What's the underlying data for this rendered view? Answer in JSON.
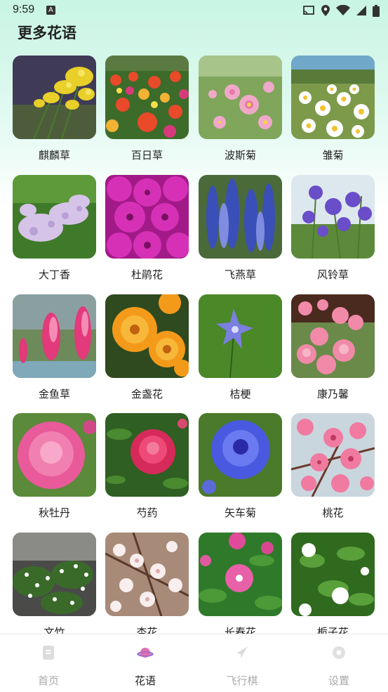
{
  "status_bar": {
    "time": "9:59",
    "badge": "A"
  },
  "page": {
    "title": "更多花语"
  },
  "flowers": [
    {
      "name": "麒麟草",
      "icon": "goldenrod-photo"
    },
    {
      "name": "百日草",
      "icon": "zinnia-photo"
    },
    {
      "name": "波斯菊",
      "icon": "cosmos-photo"
    },
    {
      "name": "雏菊",
      "icon": "daisy-photo"
    },
    {
      "name": "大丁香",
      "icon": "lilac-photo"
    },
    {
      "name": "杜鹃花",
      "icon": "azalea-photo"
    },
    {
      "name": "飞燕草",
      "icon": "larkspur-photo"
    },
    {
      "name": "风铃草",
      "icon": "bellflower-photo"
    },
    {
      "name": "金鱼草",
      "icon": "snapdragon-photo"
    },
    {
      "name": "金盏花",
      "icon": "calendula-photo"
    },
    {
      "name": "桔梗",
      "icon": "balloon-flower-photo"
    },
    {
      "name": "康乃馨",
      "icon": "carnation-photo"
    },
    {
      "name": "秋牡丹",
      "icon": "peony-photo"
    },
    {
      "name": "芍药",
      "icon": "herbaceous-peony-photo"
    },
    {
      "name": "矢车菊",
      "icon": "cornflower-photo"
    },
    {
      "name": "桃花",
      "icon": "peach-blossom-photo"
    },
    {
      "name": "文竹",
      "icon": "asparagus-fern-photo"
    },
    {
      "name": "杏花",
      "icon": "apricot-blossom-photo"
    },
    {
      "name": "长春花",
      "icon": "periwinkle-photo"
    },
    {
      "name": "栀子花",
      "icon": "gardenia-photo"
    }
  ],
  "nav": [
    {
      "label": "首页",
      "icon": "home-doc-icon",
      "active": false
    },
    {
      "label": "花语",
      "icon": "planet-icon",
      "active": true
    },
    {
      "label": "飞行棋",
      "icon": "plane-icon",
      "active": false
    },
    {
      "label": "设置",
      "icon": "settings-icon",
      "active": false
    }
  ],
  "colors": {
    "accent": "#e06fb0",
    "inactive": "#a9a9a9",
    "background_top": "#c8f5e4"
  }
}
